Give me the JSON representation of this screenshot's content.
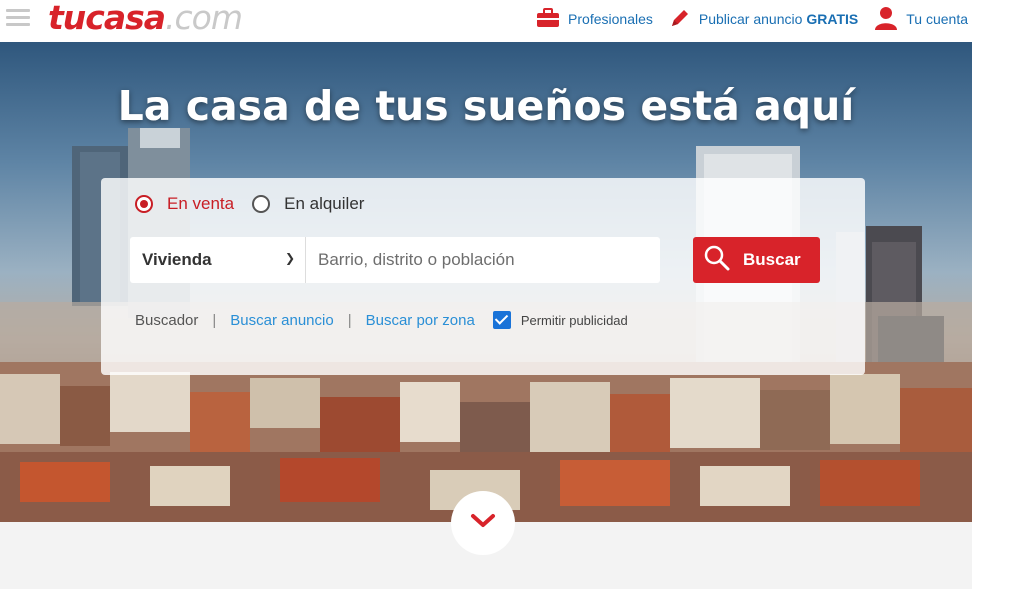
{
  "header": {
    "logo_main": "tucasa",
    "logo_suffix": ".com",
    "nav": {
      "profesionales": "Profesionales",
      "publicar_prefix": "Publicar anuncio",
      "publicar_bold": "GRATIS",
      "cuenta": "Tu cuenta"
    }
  },
  "hero": {
    "title": "La casa de tus sueños está aquí"
  },
  "search": {
    "radio_sale": "En venta",
    "radio_rent": "En alquiler",
    "selected_type": "Vivienda",
    "location_placeholder": "Barrio, distrito o población",
    "button_label": "Buscar",
    "link_buscador": "Buscador",
    "link_anuncio": "Buscar anuncio",
    "link_zona": "Buscar por zona",
    "checkbox_label": "Permitir publicidad",
    "checkbox_checked": true
  },
  "colors": {
    "brand_red": "#d8232a",
    "link_blue": "#2a8fd6",
    "nav_blue": "#1a6fb3"
  },
  "icons": {
    "menu": "hamburger-icon",
    "profesionales": "briefcase-icon",
    "publicar": "pencil-icon",
    "cuenta": "user-icon",
    "buscar": "search-icon",
    "scroll": "chevron-down-icon"
  }
}
